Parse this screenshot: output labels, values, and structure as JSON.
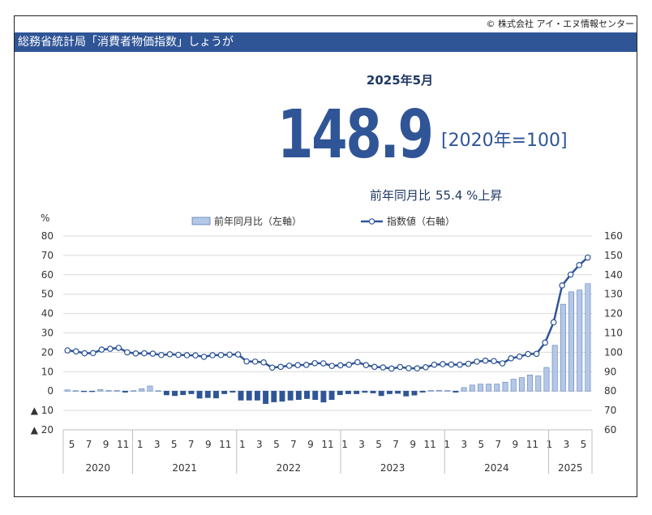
{
  "copyright": "© 株式会社 アイ・エヌ情報センター",
  "banner_title": "総務省統計局「消費者物価指数」しょうが",
  "headline": {
    "period": "2025年5月",
    "value": "148.9",
    "base": "[2020年=100]",
    "yoy_label": "前年同月比",
    "yoy_value": "55.4 %上昇"
  },
  "colors": {
    "banner": "#2f5597",
    "bar_positive": "#b4c7e7",
    "bar_negative": "#2f5597",
    "line": "#2f5597"
  },
  "chart_data": {
    "type": "bar+line",
    "left_axis_unit": "%",
    "left_ticks": [
      "80",
      "70",
      "60",
      "50",
      "40",
      "30",
      "20",
      "10",
      "0",
      "▲ 10",
      "▲ 20"
    ],
    "right_ticks": [
      "160",
      "150",
      "140",
      "130",
      "120",
      "110",
      "100",
      "90",
      "80",
      "70",
      "60"
    ],
    "ylim_left": [
      -20,
      80
    ],
    "ylim_right": [
      60,
      160
    ],
    "grid": true,
    "legend_position": "top",
    "x_month_labels": [
      "5",
      "7",
      "9",
      "11",
      "1",
      "3",
      "5",
      "7",
      "9",
      "11",
      "1",
      "3",
      "5",
      "7",
      "9",
      "11",
      "1",
      "3",
      "5",
      "7",
      "9",
      "11",
      "1",
      "3",
      "5",
      "7",
      "9",
      "11",
      "1",
      "3",
      "5"
    ],
    "year_groups": [
      {
        "label": "2020",
        "months": 8
      },
      {
        "label": "2021",
        "months": 12
      },
      {
        "label": "2022",
        "months": 12
      },
      {
        "label": "2023",
        "months": 12
      },
      {
        "label": "2024",
        "months": 12
      },
      {
        "label": "2025",
        "months": 5
      }
    ],
    "series": [
      {
        "name": "前年同月比（左軸）",
        "type": "bar",
        "axis": "left",
        "values": [
          0.6,
          0.2,
          -0.3,
          -0.2,
          0.8,
          0.3,
          0.3,
          -0.6,
          0.2,
          1.2,
          2.6,
          0.2,
          -2.0,
          -2.4,
          -1.9,
          -1.4,
          -3.7,
          -3.4,
          -3.6,
          -1.4,
          -0.6,
          -4.7,
          -4.7,
          -4.7,
          -6.5,
          -5.6,
          -5.3,
          -4.7,
          -4.4,
          -3.9,
          -4.4,
          -5.7,
          -4.4,
          -1.9,
          -1.4,
          -1.4,
          -0.7,
          -1.0,
          -2.4,
          -1.4,
          -1.2,
          -2.6,
          -2.1,
          -0.6,
          0.3,
          0.4,
          0.3,
          -0.6,
          1.8,
          3.1,
          3.6,
          3.6,
          3.6,
          4.6,
          6.1,
          6.9,
          8.3,
          7.8,
          12.2,
          23.6,
          44.8,
          51.2,
          52.1,
          55.4
        ]
      },
      {
        "name": "指数値（右軸）",
        "type": "line",
        "axis": "right",
        "values": [
          101,
          100.5,
          99.5,
          99.6,
          101.4,
          101.8,
          102.3,
          100,
          99.4,
          99.5,
          99.3,
          98.6,
          99,
          98.7,
          98.5,
          98.4,
          97.7,
          98.5,
          98.6,
          98.8,
          98.9,
          95.3,
          95.2,
          94.8,
          92.1,
          92.5,
          93.1,
          93.4,
          93.5,
          94.4,
          94.3,
          93,
          93.3,
          93.6,
          94.9,
          93.4,
          92.5,
          92.2,
          91.6,
          92.4,
          91.8,
          91.7,
          92.3,
          93.6,
          93.9,
          93.7,
          93.6,
          94.1,
          95.2,
          95.7,
          95.5,
          94.3,
          96.9,
          97.8,
          99.1,
          99.2,
          105,
          115.5,
          134.5,
          140.1,
          145,
          148.9
        ]
      }
    ]
  }
}
